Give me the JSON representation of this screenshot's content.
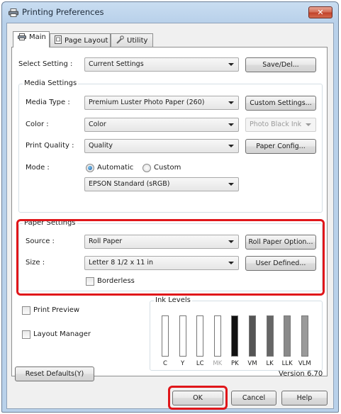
{
  "window": {
    "title": "Printing Preferences",
    "close_label": "✕"
  },
  "tabs": [
    {
      "label": "Main",
      "active": true
    },
    {
      "label": "Page Layout",
      "active": false
    },
    {
      "label": "Utility",
      "active": false
    }
  ],
  "select_setting": {
    "label": "Select Setting :",
    "value": "Current Settings",
    "button": "Save/Del..."
  },
  "media": {
    "title": "Media Settings",
    "media_type_label": "Media Type :",
    "media_type_value": "Premium Luster Photo Paper (260)",
    "custom_settings_button": "Custom Settings...",
    "color_label": "Color :",
    "color_value": "Color",
    "ink_value": "Photo Black Ink",
    "quality_label": "Print Quality :",
    "quality_value": "Quality",
    "paper_config_button": "Paper Config...",
    "mode_label": "Mode :",
    "mode_automatic": "Automatic",
    "mode_custom": "Custom",
    "mode_profile": "EPSON Standard (sRGB)"
  },
  "paper": {
    "title": "Paper Settings",
    "source_label": "Source :",
    "source_value": "Roll Paper",
    "roll_option_button": "Roll Paper Option...",
    "size_label": "Size :",
    "size_value": "Letter 8 1/2 x 11 in",
    "user_defined_button": "User Defined...",
    "borderless_label": "Borderless"
  },
  "options": {
    "print_preview": "Print Preview",
    "layout_manager": "Layout Manager"
  },
  "ink_levels": {
    "title": "Ink Levels",
    "inks": [
      {
        "name": "C",
        "level": 0.0,
        "color": "#00a0e0"
      },
      {
        "name": "Y",
        "level": 0.0,
        "color": "#f0e000"
      },
      {
        "name": "LC",
        "level": 0.0,
        "color": "#70d0f0"
      },
      {
        "name": "MK",
        "level": 0.0,
        "color": "#111111",
        "dim": true
      },
      {
        "name": "PK",
        "level": 1.0,
        "color": "#111111"
      },
      {
        "name": "VM",
        "level": 1.0,
        "color": "#555555"
      },
      {
        "name": "LK",
        "level": 1.0,
        "color": "#666666"
      },
      {
        "name": "LLK",
        "level": 1.0,
        "color": "#8a8a8a"
      },
      {
        "name": "VLM",
        "level": 1.0,
        "color": "#9a9a9a"
      }
    ]
  },
  "footer": {
    "reset_button": "Reset Defaults(Y)",
    "version": "Version 6.70",
    "ok_button": "OK",
    "cancel_button": "Cancel",
    "help_button": "Help"
  },
  "colors": {
    "highlight": "#e0161a",
    "titlebar": "#b9d1ea"
  }
}
